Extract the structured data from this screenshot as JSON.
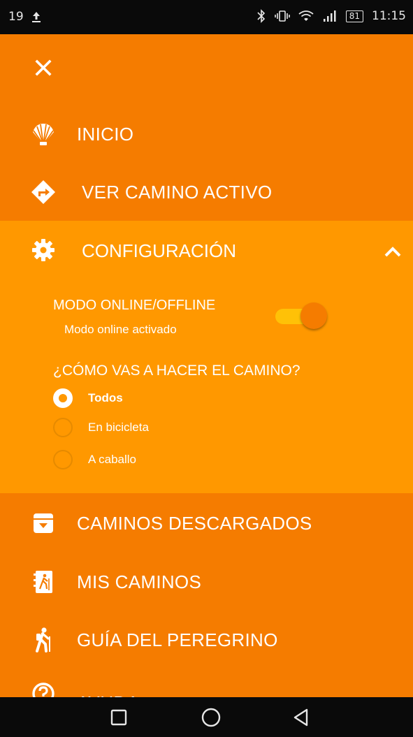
{
  "status_bar": {
    "left_number": "19",
    "battery": "81",
    "time": "11:15"
  },
  "menu": {
    "inicio": "INICIO",
    "ver_camino": "VER CAMINO ACTIVO",
    "configuracion": "CONFIGURACIÓN",
    "caminos_descargados": "CAMINOS DESCARGADOS",
    "mis_caminos": "MIS CAMINOS",
    "guia": "GUÍA DEL PEREGRINO",
    "ayuda": "AYUDA"
  },
  "config": {
    "mode_title": "MODO ONLINE/OFFLINE",
    "mode_status": "Modo online activado",
    "mode_enabled": true,
    "question": "¿CÓMO VAS A HACER EL CAMINO?",
    "options": [
      {
        "label": "Todos",
        "selected": true
      },
      {
        "label": "En bicicleta",
        "selected": false
      },
      {
        "label": "A caballo",
        "selected": false
      }
    ]
  },
  "colors": {
    "drawer_bg": "#f57c00",
    "config_bg": "#ff9800",
    "toggle_track": "#ffc107",
    "text": "#ffffff",
    "system_bars": "#0a0a0a"
  },
  "icons": [
    "close-icon",
    "shell-icon",
    "directions-icon",
    "gear-icon",
    "chevron-up-icon",
    "archive-download-icon",
    "hiking-book-icon",
    "hiker-icon",
    "help-icon",
    "upload-icon",
    "bluetooth-icon",
    "vibrate-icon",
    "wifi-icon",
    "signal-icon",
    "battery-icon",
    "recent-apps-icon",
    "home-icon",
    "back-icon"
  ]
}
